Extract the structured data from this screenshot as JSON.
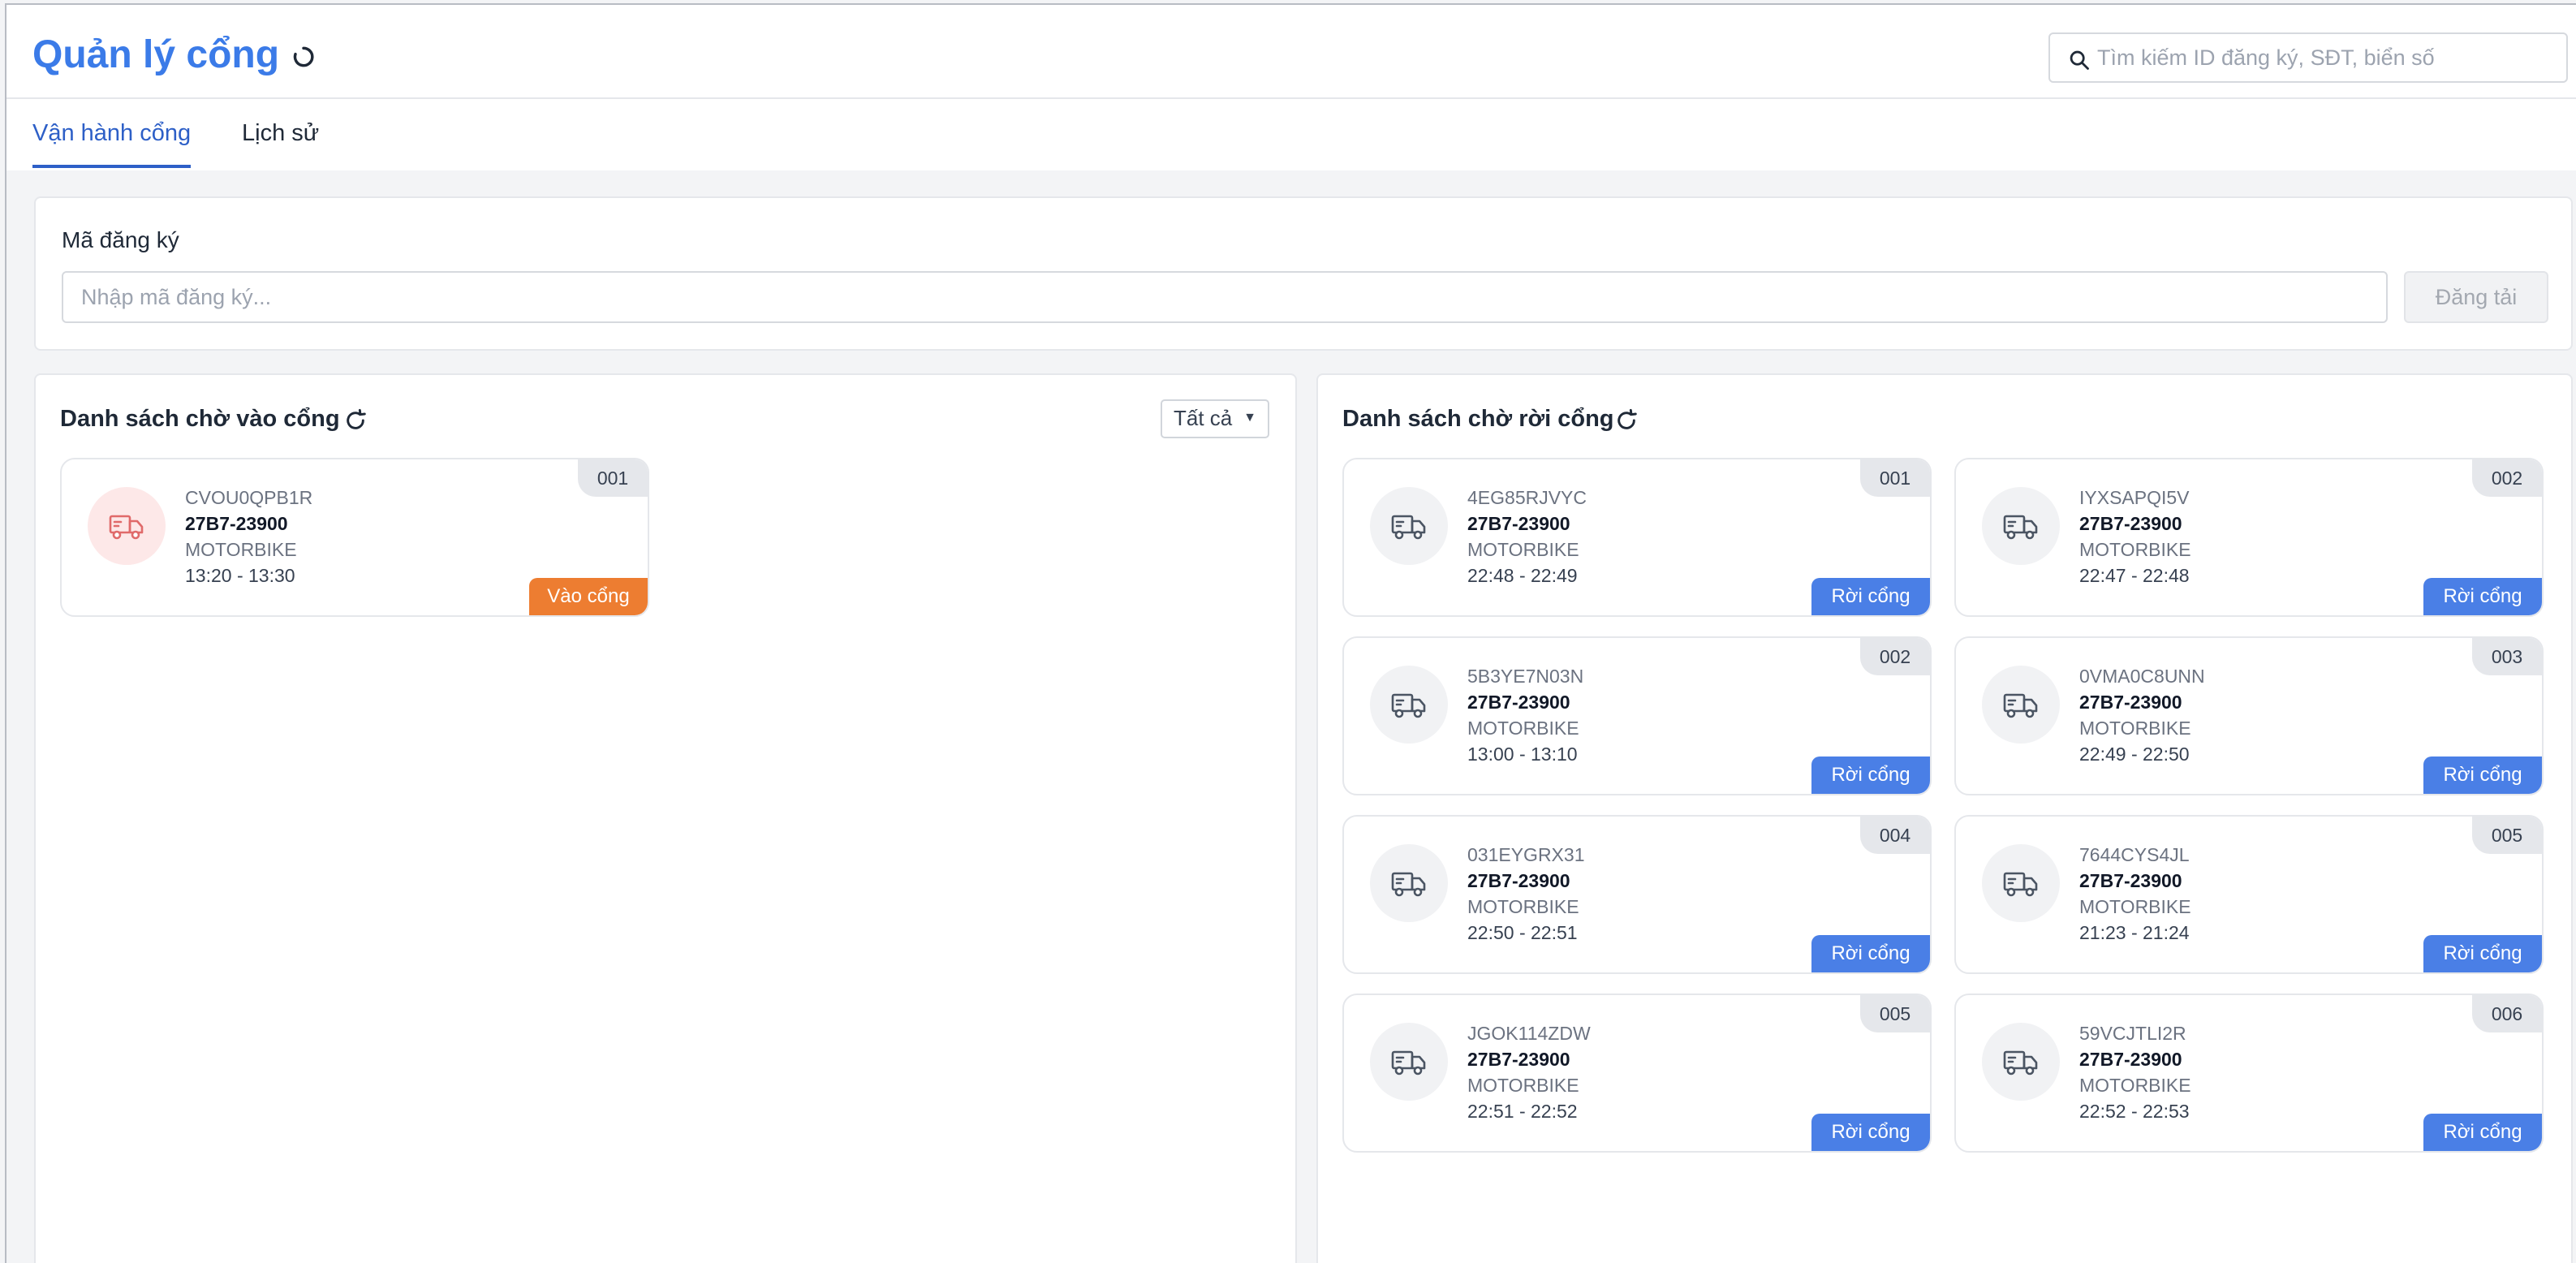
{
  "header": {
    "title": "Quản lý cổng",
    "search_placeholder": "Tìm kiếm ID đăng ký, SĐT, biển số"
  },
  "tabs": [
    {
      "label": "Vận hành cổng",
      "active": true
    },
    {
      "label": "Lịch sử",
      "active": false
    }
  ],
  "registration": {
    "label": "Mã đăng ký",
    "placeholder": "Nhập mã đăng ký...",
    "button": "Đăng tải"
  },
  "entry_list": {
    "title": "Danh sách chờ vào cổng",
    "filter": "Tất cả",
    "items": [
      {
        "num": "001",
        "code": "CVOU0QPB1R",
        "plate": "27B7-23900",
        "type": "MOTORBIKE",
        "time": "13:20 - 13:30",
        "action": "Vào cổng"
      }
    ]
  },
  "exit_list": {
    "title": "Danh sách chờ rời cổng",
    "items": [
      {
        "num": "001",
        "code": "4EG85RJVYC",
        "plate": "27B7-23900",
        "type": "MOTORBIKE",
        "time": "22:48 - 22:49",
        "action": "Rời cổng"
      },
      {
        "num": "002",
        "code": "IYXSAPQI5V",
        "plate": "27B7-23900",
        "type": "MOTORBIKE",
        "time": "22:47 - 22:48",
        "action": "Rời cổng"
      },
      {
        "num": "002",
        "code": "5B3YE7N03N",
        "plate": "27B7-23900",
        "type": "MOTORBIKE",
        "time": "13:00 - 13:10",
        "action": "Rời cổng"
      },
      {
        "num": "003",
        "code": "0VMA0C8UNN",
        "plate": "27B7-23900",
        "type": "MOTORBIKE",
        "time": "22:49 - 22:50",
        "action": "Rời cổng"
      },
      {
        "num": "004",
        "code": "031EYGRX31",
        "plate": "27B7-23900",
        "type": "MOTORBIKE",
        "time": "22:50 - 22:51",
        "action": "Rời cổng"
      },
      {
        "num": "005",
        "code": "7644CYS4JL",
        "plate": "27B7-23900",
        "type": "MOTORBIKE",
        "time": "21:23 - 21:24",
        "action": "Rời cổng"
      },
      {
        "num": "005",
        "code": "JGOK114ZDW",
        "plate": "27B7-23900",
        "type": "MOTORBIKE",
        "time": "22:51 - 22:52",
        "action": "Rời cổng"
      },
      {
        "num": "006",
        "code": "59VCJTLI2R",
        "plate": "27B7-23900",
        "type": "MOTORBIKE",
        "time": "22:52 - 22:53",
        "action": "Rời cổng"
      }
    ]
  },
  "colors": {
    "primary": "#3b7be8",
    "exit_button": "#4a7fe6",
    "entry_button": "#ed7d31",
    "truck_entry_icon": "#e06a6a",
    "truck_exit_icon": "#4b5563"
  },
  "icons": {
    "title_refresh": "refresh-icon",
    "search": "search-icon",
    "vehicle": "truck-icon"
  }
}
